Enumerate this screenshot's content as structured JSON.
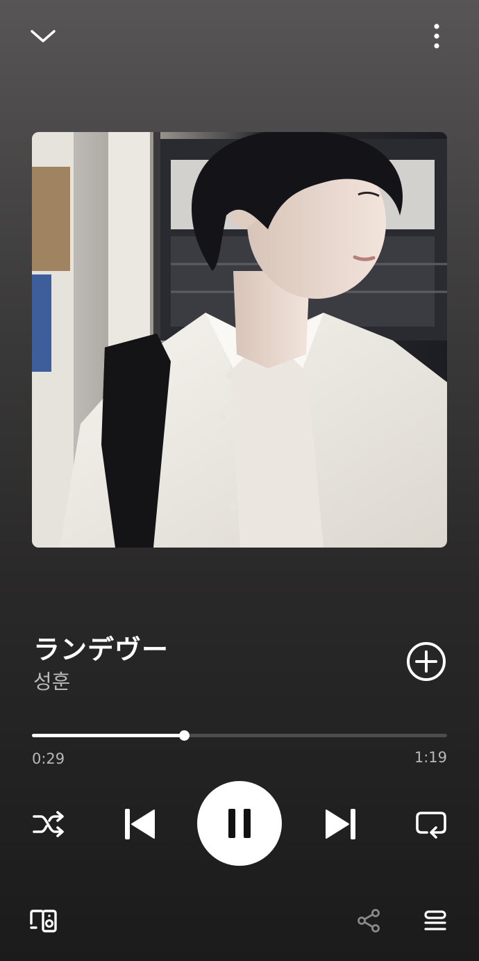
{
  "track": {
    "title": "ランデヴー",
    "artist": "성훈"
  },
  "playback": {
    "elapsed": "0:29",
    "total": "1:19",
    "progress_percent": 36.7,
    "state": "playing"
  },
  "icons": {
    "collapse": "chevron-down-icon",
    "more": "more-vertical-icon",
    "add": "add-circle-icon",
    "shuffle": "shuffle-icon",
    "previous": "skip-previous-icon",
    "pause": "pause-icon",
    "next": "skip-next-icon",
    "repeat": "repeat-icon",
    "device": "connect-device-icon",
    "share": "share-icon",
    "queue": "queue-icon"
  },
  "colors": {
    "background_top": "#575555",
    "background_bottom": "#1b1b1b",
    "progress_fill": "#ffffff",
    "progress_track": "#4d4d4d",
    "secondary_text": "#b9b9b9"
  }
}
